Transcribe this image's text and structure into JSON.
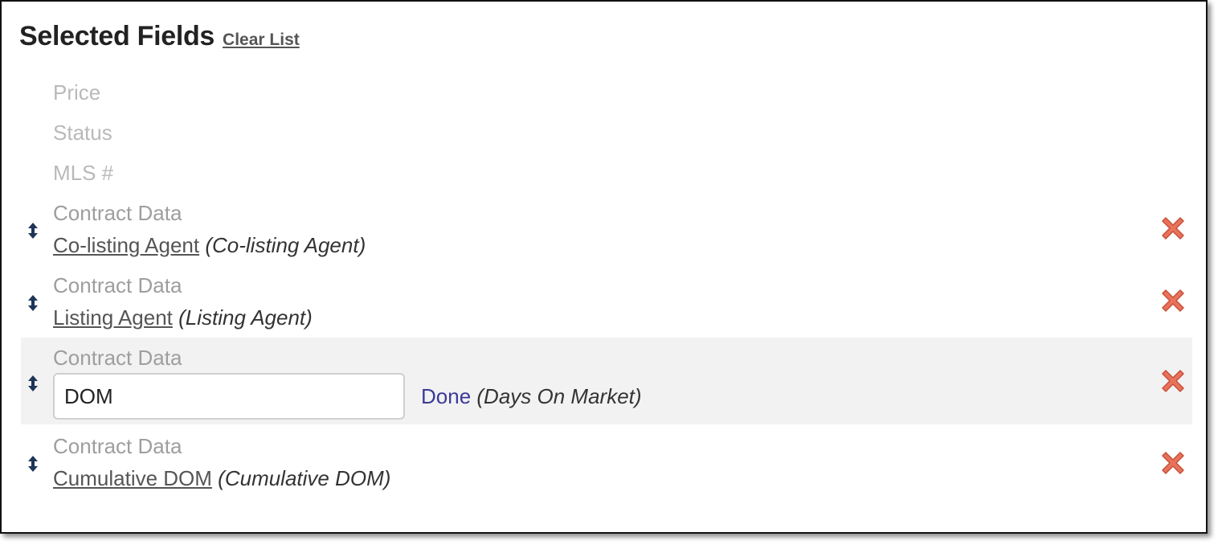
{
  "header": {
    "title": "Selected Fields",
    "clear_label": "Clear List"
  },
  "fixed_fields": [
    "Price",
    "Status",
    "MLS #"
  ],
  "rows": [
    {
      "group": "Contract Data",
      "field": "Co-listing Agent",
      "desc": "(Co-listing Agent)"
    },
    {
      "group": "Contract Data",
      "field": "Listing Agent",
      "desc": "(Listing Agent)"
    },
    {
      "group": "Contract Data",
      "input_value": "DOM",
      "done_label": "Done",
      "desc": "(Days On Market)"
    },
    {
      "group": "Contract Data",
      "field": "Cumulative DOM",
      "desc": "(Cumulative DOM)"
    }
  ],
  "icons": {
    "drag": "drag-handle-icon",
    "remove": "remove-x-icon"
  },
  "colors": {
    "remove": "#e8735c",
    "handle": "#1d3557",
    "done": "#3b3b9a",
    "edit_row_bg": "#f2f2f2"
  }
}
